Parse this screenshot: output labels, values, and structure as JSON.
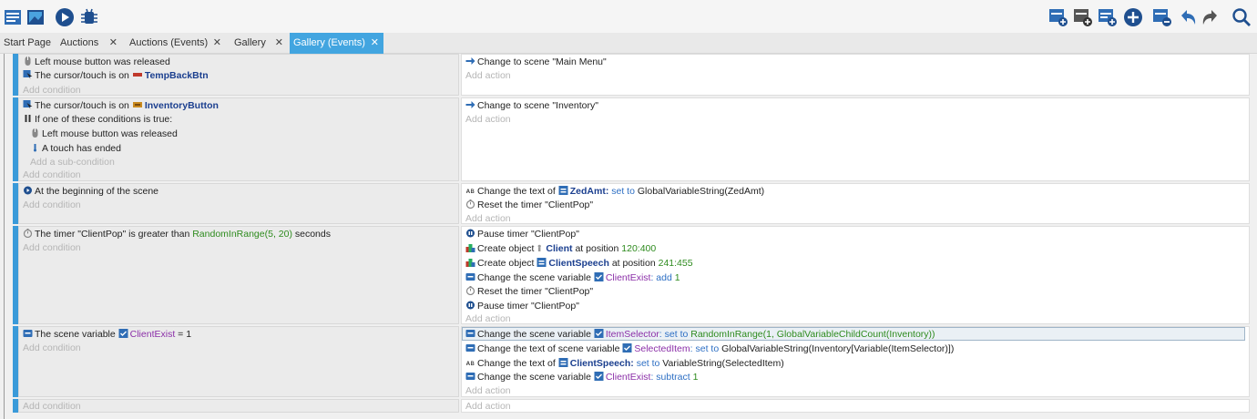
{
  "toolbar": {
    "left_icons": [
      "events-list-icon",
      "scene-editor-icon",
      "preview-play-icon",
      "debugger-icon"
    ],
    "right_icons": [
      "add-event-icon",
      "add-subevent-icon",
      "add-comment-icon",
      "add-instruction-icon",
      "delete-icon",
      "undo-icon",
      "redo-icon",
      "search-icon"
    ]
  },
  "tabs": [
    {
      "label": "Start Page",
      "closable": false,
      "active": false
    },
    {
      "label": "Auctions",
      "closable": true,
      "active": false
    },
    {
      "label": "Auctions (Events)",
      "closable": true,
      "active": false
    },
    {
      "label": "Gallery",
      "closable": true,
      "active": false
    },
    {
      "label": "Gallery (Events)",
      "closable": true,
      "active": true
    }
  ],
  "close_glyph": "✕",
  "events": {
    "e1": {
      "c1": {
        "left": "Left",
        "mid": "mouse button was released"
      },
      "c2": {
        "text": "The cursor/touch is on",
        "obj": "TempBackBtn"
      },
      "add_condition": "Add condition",
      "a1": {
        "text": "Change to scene",
        "val": "\"Main Menu\""
      },
      "add_action": "Add action"
    },
    "e2": {
      "c1": {
        "text": "The cursor/touch is on",
        "obj": "InventoryButton"
      },
      "c2": {
        "text": "If one of these conditions is true:"
      },
      "c3": {
        "left": "Left",
        "mid": "mouse button was released"
      },
      "c4": {
        "text": "A touch has ended"
      },
      "add_subcondition": "Add a sub-condition",
      "add_condition": "Add condition",
      "a1": {
        "text": "Change to scene",
        "val": "\"Inventory\""
      },
      "add_action": "Add action"
    },
    "e3": {
      "c1": {
        "text": "At the beginning of the scene"
      },
      "add_condition": "Add condition",
      "a1": {
        "text": "Change the text of",
        "obj": "ZedAmt",
        "sep": ":",
        "op": "set to",
        "val": "GlobalVariableString(ZedAmt)"
      },
      "a2": {
        "text": "Reset the timer",
        "val": "\"ClientPop\""
      },
      "add_action": "Add action"
    },
    "e4": {
      "c1": {
        "text": "The timer \"ClientPop\" is greater than",
        "val": "RandomInRange(5, 20)",
        "unit": "seconds"
      },
      "add_condition": "Add condition",
      "a1": {
        "text": "Pause timer",
        "val": "\"ClientPop\""
      },
      "a2": {
        "text": "Create object",
        "obj": "Client",
        "pre": "at position",
        "val": "120:400"
      },
      "a3": {
        "text": "Create object",
        "obj": "ClientSpeech",
        "pre": "at position",
        "val": "241:455"
      },
      "a4": {
        "text": "Change the scene variable",
        "var": "ClientExist",
        "sep": ":",
        "op": "add",
        "val": "1"
      },
      "a5": {
        "text": "Reset the timer",
        "val": "\"ClientPop\""
      },
      "a6": {
        "text": "Pause timer",
        "val": "\"ClientPop\""
      },
      "add_action": "Add action"
    },
    "e5": {
      "c1": {
        "text": "The scene variable",
        "var": "ClientExist",
        "op": "=",
        "val": "1"
      },
      "add_condition": "Add condition",
      "a1": {
        "text": "Change the scene variable",
        "var": "ItemSelector",
        "sep": ":",
        "op": "set to",
        "val": "RandomInRange(1, GlobalVariableChildCount(Inventory))"
      },
      "a2": {
        "text": "Change the text of scene variable",
        "var": "SelectedItem",
        "sep": ":",
        "op": "set to",
        "val": "GlobalVariableString(Inventory[Variable(ItemSelector)])"
      },
      "a3": {
        "text": "Change the text of",
        "obj": "ClientSpeech",
        "sep": ":",
        "op": "set to",
        "val": "VariableString(SelectedItem)"
      },
      "a4": {
        "text": "Change the scene variable",
        "var": "ClientExist",
        "sep": ":",
        "op": "subtract",
        "val": "1"
      },
      "add_action": "Add action"
    },
    "e6": {
      "add_condition": "Add condition",
      "add_action": "Add action"
    }
  },
  "colors": {
    "accent": "#42a5e0",
    "event_bar": "#3a9ad9",
    "keyword": "#2d6fc4",
    "number": "#2e8b1e",
    "variable": "#8b2fa8",
    "object": "#1b3f8f"
  }
}
